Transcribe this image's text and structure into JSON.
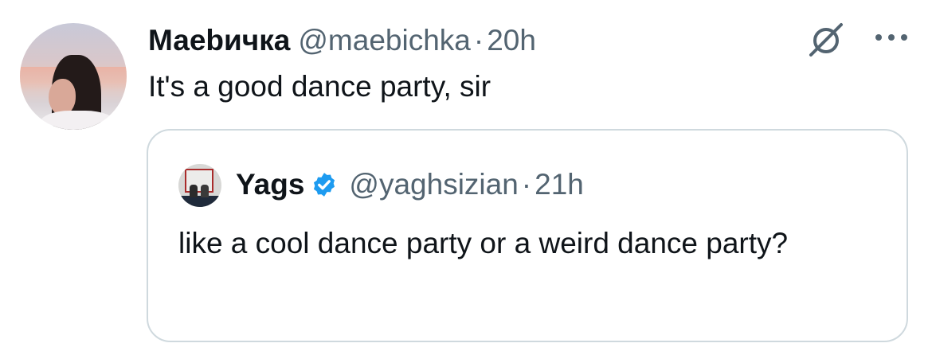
{
  "tweet": {
    "author": {
      "display_name": "Маеbичка",
      "handle": "@maebichka",
      "separator": "·",
      "time": "20h"
    },
    "text": "It's a good dance party, sir",
    "actions": {
      "grok_icon": "grok-icon",
      "more_icon": "more-horizontal-icon"
    }
  },
  "quoted_tweet": {
    "author": {
      "display_name": "Yags",
      "verified_icon": "verified-badge-icon",
      "handle": "@yaghsizian",
      "separator": "·",
      "time": "21h"
    },
    "text": "like a cool dance party or a weird dance party?"
  },
  "colors": {
    "text_primary": "#0f1419",
    "text_secondary": "#536471",
    "border": "#cfd9de",
    "verified_blue": "#1d9bf0"
  }
}
